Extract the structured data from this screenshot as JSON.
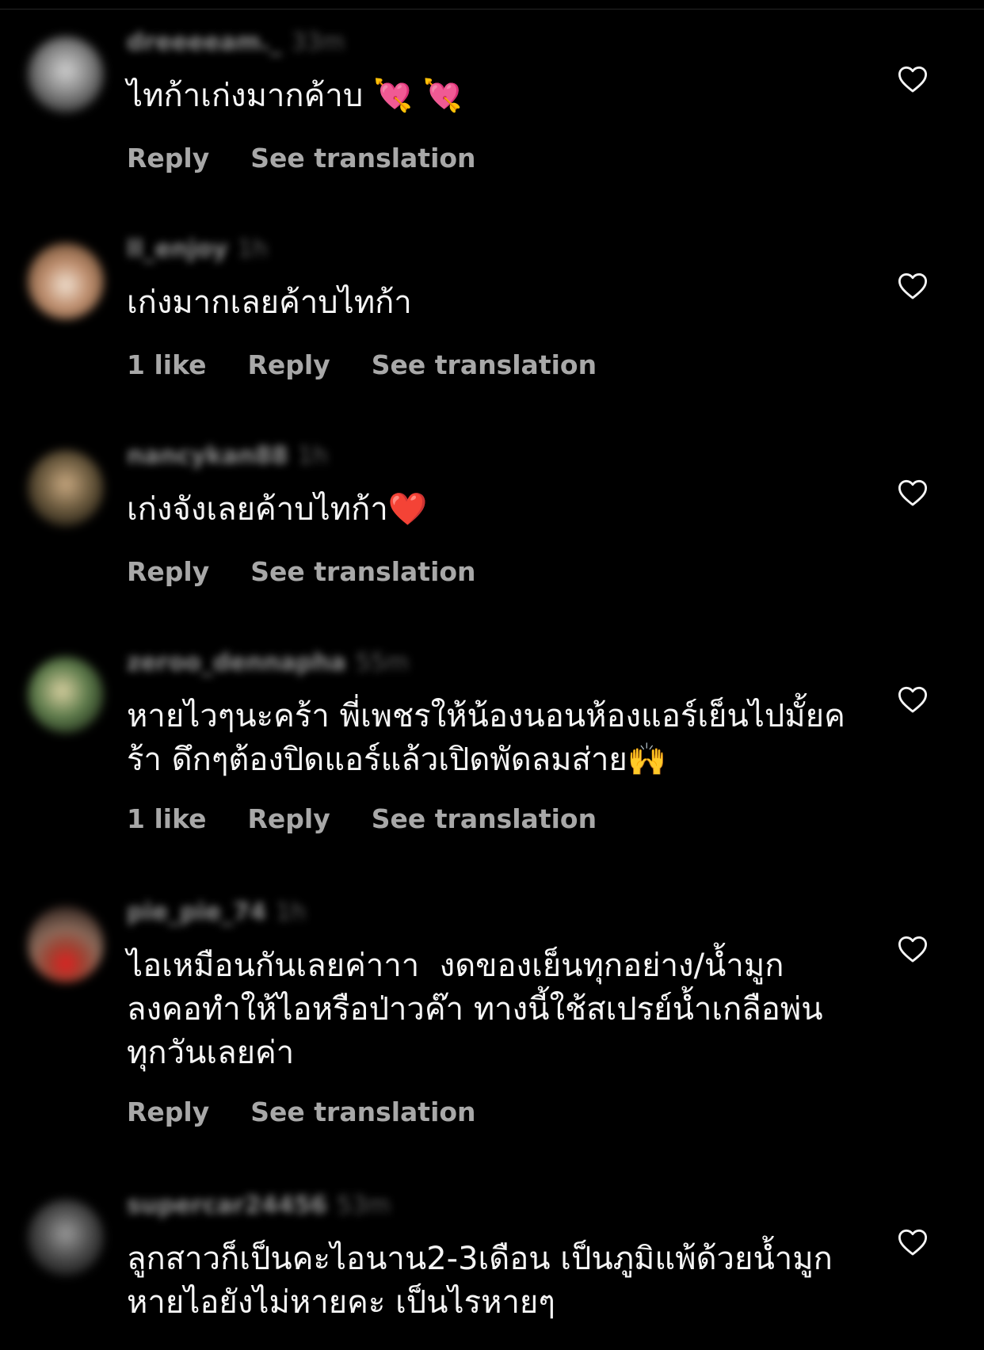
{
  "comments": [
    {
      "username": "dreeeeam._",
      "time": "33m",
      "text": "ไทก้าเก่งมากค้าบ 💘 💘",
      "likes": "",
      "reply_label": "Reply",
      "translate_label": "See translation",
      "avatar_color": "#8a8a8a",
      "like_icon": "heart-outline-icon"
    },
    {
      "username": "ll_enjoy",
      "time": "1h",
      "text": "เก่งมากเลยค้าบไทก้า",
      "likes": "1 like",
      "reply_label": "Reply",
      "translate_label": "See translation",
      "avatar_color": "#b58a6a",
      "like_icon": "heart-outline-icon"
    },
    {
      "username": "nancykan88",
      "time": "1h",
      "text": "เก่งจังเลยค้าบไทก้า❤️",
      "likes": "",
      "reply_label": "Reply",
      "translate_label": "See translation",
      "avatar_color": "#6b5a3e",
      "like_icon": "heart-outline-icon"
    },
    {
      "username": "zeroo_dennapha",
      "time": "55m",
      "text": "หายไวๆนะคร้า พี่เพชรให้น้องนอนห้องแอร์เย็นไปมั้ยคร้า ดึกๆต้องปิดแอร์แล้วเปิดพัดลมส่าย🙌",
      "likes": "1 like",
      "reply_label": "Reply",
      "translate_label": "See translation",
      "avatar_color": "#5c7a4a",
      "like_icon": "heart-outline-icon"
    },
    {
      "username": "pie_pie_74",
      "time": "1h",
      "text": "ไอเหมือนกันเลยค่าาา  งดของเย็นทุกอย่าง/น้ำมูกลงคอทำให้ไอหรือป่าวค๊า ทางนี้ใช้สเปรย์น้ำเกลือพ่นทุกวันเลยค่า",
      "likes": "",
      "reply_label": "Reply",
      "translate_label": "See translation",
      "avatar_color": "#8a6a5a",
      "like_icon": "heart-outline-icon"
    },
    {
      "username": "supercar24456",
      "time": "53m",
      "text": "ลูกสาวก็เป็นคะไอนาน2-3เดือน เป็นภูมิแพ้ด้วยน้ำมูกหายไอยังไม่หายคะ เป็นไรหายๆ",
      "likes": "",
      "reply_label": "",
      "translate_label": "",
      "avatar_color": "#4a4a4a",
      "like_icon": "heart-outline-icon"
    }
  ]
}
